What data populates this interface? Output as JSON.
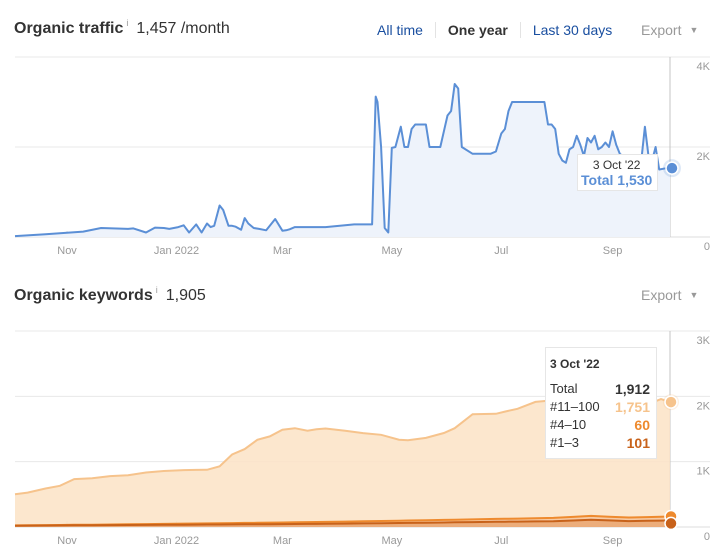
{
  "traffic": {
    "title": "Organic traffic",
    "info_icon": "info-icon",
    "value": "1,457 /month",
    "ranges": [
      {
        "label": "All time",
        "active": false
      },
      {
        "label": "One year",
        "active": true
      },
      {
        "label": "Last 30 days",
        "active": false
      }
    ],
    "export_label": "Export",
    "tooltip": {
      "date": "3 Oct '22",
      "label": "Total 1,530"
    }
  },
  "keywords": {
    "title": "Organic keywords",
    "info_icon": "info-icon",
    "value": "1,905",
    "export_label": "Export",
    "tooltip": {
      "date": "3 Oct '22",
      "rows": [
        {
          "label": "Total",
          "value": "1,912"
        },
        {
          "label": "#11–100",
          "value": "1,751"
        },
        {
          "label": "#4–10",
          "value": "60"
        },
        {
          "label": "#1–3",
          "value": "101"
        }
      ]
    }
  },
  "colors": {
    "traffic_line": "#5b8fd6",
    "traffic_fill": "#eef3fb",
    "kw_11_100": "#f6c38c",
    "kw_11_100_fill": "#fbe3c6",
    "kw_4_10": "#ee8a2e",
    "kw_1_3": "#c8621a",
    "link": "#1a4fa0",
    "grid": "#e8e8e8",
    "axis_text": "#999999"
  },
  "chart_data": [
    {
      "type": "line",
      "title": "Organic traffic",
      "xlabel": "",
      "ylabel": "",
      "x_ticks": [
        "Nov",
        "Jan 2022",
        "Mar",
        "May",
        "Jul",
        "Sep"
      ],
      "y_ticks": [
        "0",
        "2K",
        "4K"
      ],
      "ylim": [
        0,
        4000
      ],
      "x_range": [
        "2021-10-03",
        "2022-10-03"
      ],
      "grid": true,
      "series": [
        {
          "name": "Total",
          "x": [
            "2021-10-03",
            "2021-10-20",
            "2021-11-10",
            "2021-11-20",
            "2021-12-05",
            "2021-12-08",
            "2021-12-15",
            "2021-12-20",
            "2021-12-25",
            "2021-12-28",
            "2022-01-02",
            "2022-01-05",
            "2022-01-08",
            "2022-01-12",
            "2022-01-15",
            "2022-01-18",
            "2022-01-20",
            "2022-01-22",
            "2022-01-25",
            "2022-01-27",
            "2022-01-30",
            "2022-02-01",
            "2022-02-03",
            "2022-02-06",
            "2022-02-08",
            "2022-02-10",
            "2022-02-13",
            "2022-02-16",
            "2022-02-20",
            "2022-02-25",
            "2022-03-01",
            "2022-03-03",
            "2022-03-05",
            "2022-03-08",
            "2022-03-15",
            "2022-03-25",
            "2022-04-10",
            "2022-04-20",
            "2022-04-22",
            "2022-04-23",
            "2022-04-25",
            "2022-04-27",
            "2022-04-29",
            "2022-05-01",
            "2022-05-03",
            "2022-05-06",
            "2022-05-08",
            "2022-05-10",
            "2022-05-12",
            "2022-05-14",
            "2022-05-20",
            "2022-05-22",
            "2022-05-25",
            "2022-05-28",
            "2022-06-01",
            "2022-06-03",
            "2022-06-05",
            "2022-06-07",
            "2022-06-09",
            "2022-06-15",
            "2022-06-25",
            "2022-06-28",
            "2022-07-01",
            "2022-07-03",
            "2022-07-05",
            "2022-07-07",
            "2022-07-20",
            "2022-07-25",
            "2022-07-27",
            "2022-07-29",
            "2022-07-31",
            "2022-08-02",
            "2022-08-04",
            "2022-08-06",
            "2022-08-08",
            "2022-08-10",
            "2022-08-12",
            "2022-08-14",
            "2022-08-16",
            "2022-08-18",
            "2022-08-20",
            "2022-08-22",
            "2022-08-24",
            "2022-08-26",
            "2022-08-28",
            "2022-08-30",
            "2022-09-01",
            "2022-09-03",
            "2022-09-05",
            "2022-09-10",
            "2022-09-15",
            "2022-09-17",
            "2022-09-19",
            "2022-09-21",
            "2022-09-23",
            "2022-09-25",
            "2022-09-27",
            "2022-10-01",
            "2022-10-03"
          ],
          "values": [
            20,
            60,
            120,
            200,
            180,
            190,
            100,
            210,
            200,
            180,
            220,
            260,
            100,
            280,
            100,
            300,
            220,
            250,
            700,
            600,
            250,
            250,
            230,
            160,
            420,
            300,
            200,
            180,
            150,
            400,
            140,
            150,
            170,
            220,
            220,
            220,
            280,
            280,
            3120,
            3000,
            2000,
            200,
            100,
            1980,
            2000,
            2450,
            2000,
            2000,
            2400,
            2500,
            2500,
            2000,
            2000,
            2000,
            2700,
            2800,
            3400,
            3300,
            2000,
            1850,
            1850,
            1900,
            2300,
            2400,
            2800,
            3000,
            3000,
            3000,
            2500,
            2500,
            2400,
            1850,
            1700,
            1650,
            1950,
            2000,
            2250,
            2050,
            1800,
            2200,
            2100,
            2250,
            1950,
            2000,
            2100,
            2000,
            2350,
            2050,
            1850,
            1700,
            1700,
            1700,
            2450,
            1800,
            1700,
            2000,
            1500,
            1530,
            1530
          ]
        }
      ],
      "hover": {
        "date": "3 Oct '22",
        "value": 1530
      }
    },
    {
      "type": "area",
      "title": "Organic keywords",
      "xlabel": "",
      "ylabel": "",
      "x_ticks": [
        "Nov",
        "Jan 2022",
        "Mar",
        "May",
        "Jul",
        "Sep"
      ],
      "y_ticks": [
        "0",
        "1K",
        "2K",
        "3K"
      ],
      "ylim": [
        0,
        3000
      ],
      "x_range": [
        "2021-10-03",
        "2022-10-03"
      ],
      "stacked": true,
      "grid": true,
      "series": [
        {
          "name": "#1–3",
          "x": [
            "2021-10-03",
            "2021-12-01",
            "2022-02-01",
            "2022-04-01",
            "2022-06-01",
            "2022-08-01",
            "2022-08-20",
            "2022-09-10",
            "2022-10-03"
          ],
          "values": [
            20,
            30,
            40,
            50,
            70,
            90,
            110,
            90,
            101
          ]
        },
        {
          "name": "#4–10",
          "x": [
            "2021-10-03",
            "2021-12-01",
            "2022-02-01",
            "2022-04-01",
            "2022-06-01",
            "2022-08-01",
            "2022-08-20",
            "2022-09-10",
            "2022-10-03"
          ],
          "values": [
            5,
            10,
            20,
            30,
            40,
            50,
            60,
            55,
            60
          ]
        },
        {
          "name": "#11–100",
          "x": [
            "2021-10-03",
            "2021-10-10",
            "2021-10-20",
            "2021-10-28",
            "2021-11-05",
            "2021-11-15",
            "2021-11-25",
            "2021-12-05",
            "2021-12-15",
            "2021-12-25",
            "2022-01-05",
            "2022-01-12",
            "2022-01-18",
            "2022-01-25",
            "2022-02-01",
            "2022-02-08",
            "2022-02-15",
            "2022-02-22",
            "2022-03-01",
            "2022-03-08",
            "2022-03-15",
            "2022-03-20",
            "2022-03-25",
            "2022-04-05",
            "2022-04-15",
            "2022-04-25",
            "2022-05-05",
            "2022-05-10",
            "2022-05-20",
            "2022-05-30",
            "2022-06-05",
            "2022-06-15",
            "2022-06-28",
            "2022-07-03",
            "2022-07-10",
            "2022-07-20",
            "2022-07-30",
            "2022-08-10",
            "2022-08-20",
            "2022-08-30",
            "2022-09-10",
            "2022-09-20",
            "2022-09-28",
            "2022-10-03"
          ],
          "values": [
            475,
            500,
            560,
            600,
            700,
            710,
            740,
            750,
            790,
            810,
            820,
            820,
            820,
            870,
            1050,
            1130,
            1270,
            1320,
            1420,
            1440,
            1400,
            1420,
            1430,
            1390,
            1350,
            1320,
            1240,
            1230,
            1260,
            1330,
            1400,
            1610,
            1610,
            1640,
            1680,
            1780,
            1800,
            1780,
            1780,
            1780,
            1720,
            1720,
            1800,
            1751
          ]
        }
      ],
      "hover": {
        "date": "3 Oct '22",
        "total": 1912,
        "#11–100": 1751,
        "#4–10": 60,
        "#1–3": 101
      }
    }
  ]
}
